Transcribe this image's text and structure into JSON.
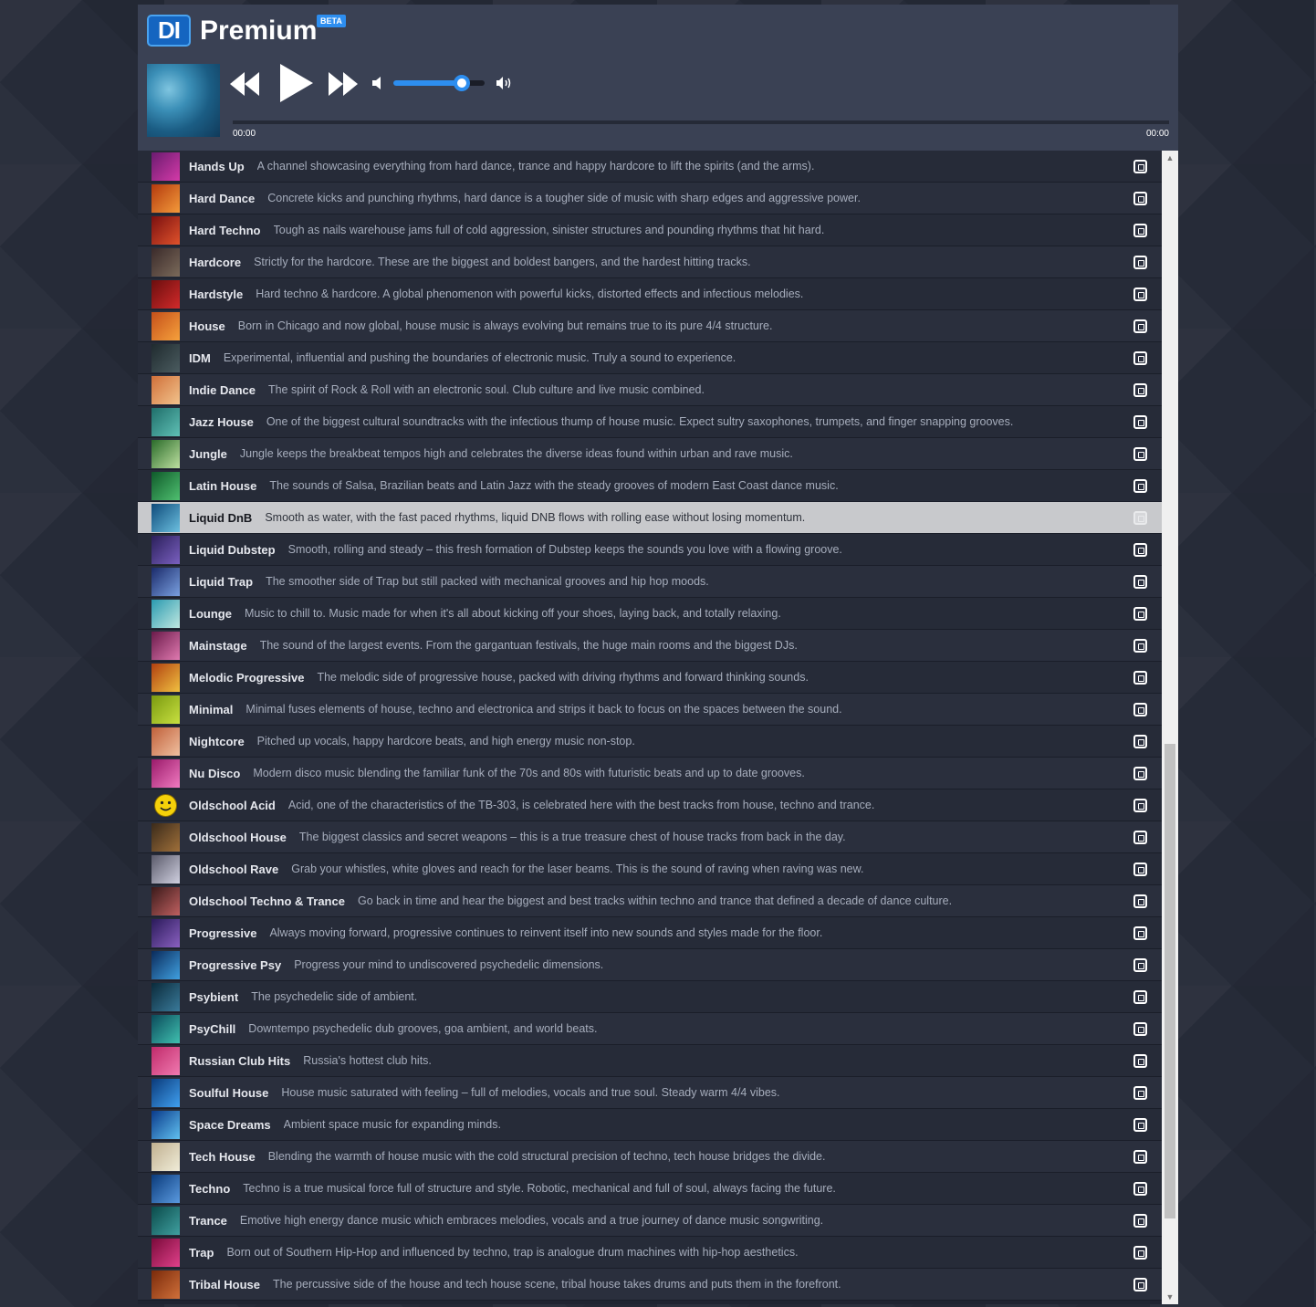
{
  "header": {
    "logo_text": "DI",
    "brand": "Premium",
    "beta": "BETA",
    "time_current": "00:00",
    "time_total": "00:00",
    "volume_percent": 75,
    "progress_percent": 0
  },
  "colors": {
    "accent": "#2d8ef0",
    "header_bg": "#3a4154",
    "list_bg": "#262b38",
    "selected_bg": "#c8c9cc"
  },
  "channels": [
    {
      "name": "Hands Up",
      "desc": "A channel showcasing everything from hard dance, trance and happy hardcore to lift the spirits (and the arms).",
      "thumb": [
        "#6a1b6f",
        "#d43aa8"
      ]
    },
    {
      "name": "Hard Dance",
      "desc": "Concrete kicks and punching rhythms, hard dance is a tougher side of music with sharp edges and aggressive power.",
      "thumb": [
        "#b33a0e",
        "#f39a3a"
      ]
    },
    {
      "name": "Hard Techno",
      "desc": "Tough as nails warehouse jams full of cold aggression, sinister structures and pounding rhythms that hit hard.",
      "thumb": [
        "#7a1010",
        "#e0522b"
      ]
    },
    {
      "name": "Hardcore",
      "desc": "Strictly for the hardcore. These are the biggest and boldest bangers, and the hardest hitting tracks.",
      "thumb": [
        "#3a2a2a",
        "#7b6a5a"
      ]
    },
    {
      "name": "Hardstyle",
      "desc": "Hard techno & hardcore. A global phenomenon with powerful kicks, distorted effects and infectious melodies.",
      "thumb": [
        "#6a0e0e",
        "#d22a2a"
      ]
    },
    {
      "name": "House",
      "desc": "Born in Chicago and now global, house music is always evolving but remains true to its pure 4/4 structure.",
      "thumb": [
        "#c4501a",
        "#f6a13c"
      ]
    },
    {
      "name": "IDM",
      "desc": "Experimental, influential and pushing the boundaries of electronic music. Truly a sound to experience.",
      "thumb": [
        "#1f2a2e",
        "#4b5c60"
      ]
    },
    {
      "name": "Indie Dance",
      "desc": "The spirit of Rock & Roll with an electronic soul. Club culture and live music combined.",
      "thumb": [
        "#d0703a",
        "#f2c38c"
      ]
    },
    {
      "name": "Jazz House",
      "desc": "One of the biggest cultural soundtracks with the infectious thump of house music. Expect sultry saxophones, trumpets, and finger snapping grooves.",
      "thumb": [
        "#1f6e6a",
        "#5fc0b5"
      ]
    },
    {
      "name": "Jungle",
      "desc": "Jungle keeps the breakbeat tempos high and celebrates the diverse ideas found within urban and rave music.",
      "thumb": [
        "#2a6b2a",
        "#bde0a0"
      ]
    },
    {
      "name": "Latin House",
      "desc": "The sounds of Salsa, Brazilian beats and Latin Jazz with the steady grooves of modern East Coast dance music.",
      "thumb": [
        "#0f5a2a",
        "#4fc070"
      ]
    },
    {
      "name": "Liquid DnB",
      "desc": "Smooth as water, with the fast paced rhythms, liquid DNB flows with rolling ease without losing momentum.",
      "thumb": [
        "#0e4a7a",
        "#6cc0e0"
      ],
      "selected": true
    },
    {
      "name": "Liquid Dubstep",
      "desc": "Smooth, rolling and steady – this fresh formation of Dubstep keeps the sounds you love with a flowing groove.",
      "thumb": [
        "#2a1f5a",
        "#7a60c0"
      ]
    },
    {
      "name": "Liquid Trap",
      "desc": "The smoother side of Trap but still packed with mechanical grooves and hip hop moods.",
      "thumb": [
        "#1a2a6a",
        "#7aa0e0"
      ]
    },
    {
      "name": "Lounge",
      "desc": "Music to chill to. Music made for when it's all about kicking off your shoes, laying back, and totally relaxing.",
      "thumb": [
        "#2a9ab0",
        "#c0e8e0"
      ]
    },
    {
      "name": "Mainstage",
      "desc": "The sound of the largest events. From the gargantuan festivals, the huge main rooms and the biggest DJs.",
      "thumb": [
        "#6a1a4a",
        "#e07ab0"
      ]
    },
    {
      "name": "Melodic Progressive",
      "desc": "The melodic side of progressive house, packed with driving rhythms and forward thinking sounds.",
      "thumb": [
        "#b04010",
        "#f0c040"
      ]
    },
    {
      "name": "Minimal",
      "desc": "Minimal fuses elements of house, techno and electronica and strips it back to focus on the spaces between the sound.",
      "thumb": [
        "#7a9a10",
        "#c8e040"
      ]
    },
    {
      "name": "Nightcore",
      "desc": "Pitched up vocals, happy hardcore beats, and high energy music non-stop.",
      "thumb": [
        "#c0603a",
        "#f0c0a0"
      ]
    },
    {
      "name": "Nu Disco",
      "desc": "Modern disco music blending the familiar funk of the 70s and 80s with futuristic beats and up to date grooves.",
      "thumb": [
        "#9a1a6a",
        "#f07ac0"
      ]
    },
    {
      "name": "Oldschool Acid",
      "desc": "Acid, one of the characteristics of the TB-303, is celebrated here with the best tracks from house, techno and trance.",
      "thumb": [
        "#262b38",
        "#262b38"
      ],
      "smiley": true
    },
    {
      "name": "Oldschool House",
      "desc": "The biggest classics and secret weapons – this is a true treasure chest of house tracks from back in the day.",
      "thumb": [
        "#3a2a1a",
        "#a0703a"
      ]
    },
    {
      "name": "Oldschool Rave",
      "desc": "Grab your whistles, white gloves and reach for the laser beams. This is the sound of raving when raving was new.",
      "thumb": [
        "#5a5a6a",
        "#d0d0e0"
      ]
    },
    {
      "name": "Oldschool Techno & Trance",
      "desc": "Go back in time and hear the biggest and best tracks within techno and trance that defined a decade of dance culture.",
      "thumb": [
        "#3a1a1a",
        "#c06060"
      ]
    },
    {
      "name": "Progressive",
      "desc": "Always moving forward, progressive continues to reinvent itself into new sounds and styles made for the floor.",
      "thumb": [
        "#2a1a5a",
        "#8a60c0"
      ]
    },
    {
      "name": "Progressive Psy",
      "desc": "Progress your mind to undiscovered psychedelic dimensions.",
      "thumb": [
        "#0a2a5a",
        "#40a0e0"
      ]
    },
    {
      "name": "Psybient",
      "desc": "The psychedelic side of ambient.",
      "thumb": [
        "#0a2a3a",
        "#3a7a9a"
      ]
    },
    {
      "name": "PsyChill",
      "desc": "Downtempo psychedelic dub grooves, goa ambient, and world beats.",
      "thumb": [
        "#0a4a5a",
        "#40c0b0"
      ]
    },
    {
      "name": "Russian Club Hits",
      "desc": "Russia's hottest club hits.",
      "thumb": [
        "#c02a6a",
        "#f07ab0"
      ]
    },
    {
      "name": "Soulful House",
      "desc": "House music saturated with feeling – full of melodies, vocals and true soul. Steady warm 4/4 vibes.",
      "thumb": [
        "#0a3a7a",
        "#40a0f0"
      ]
    },
    {
      "name": "Space Dreams",
      "desc": "Ambient space music for expanding minds.",
      "thumb": [
        "#0a3a8a",
        "#60c0f0"
      ]
    },
    {
      "name": "Tech House",
      "desc": "Blending the warmth of house music with the cold structural precision of techno, tech house bridges the divide.",
      "thumb": [
        "#c0b090",
        "#f0ecd8"
      ]
    },
    {
      "name": "Techno",
      "desc": "Techno is a true musical force full of structure and style. Robotic, mechanical and full of soul, always facing the future.",
      "thumb": [
        "#0a3a7a",
        "#5a9ae0"
      ]
    },
    {
      "name": "Trance",
      "desc": "Emotive high energy dance music which embraces melodies, vocals and a true journey of dance music songwriting.",
      "thumb": [
        "#0a4a4a",
        "#40a0a0"
      ]
    },
    {
      "name": "Trap",
      "desc": "Born out of Southern Hip-Hop and influenced by techno, trap is analogue drum machines with hip-hop aesthetics.",
      "thumb": [
        "#7a0a3a",
        "#e0408a"
      ]
    },
    {
      "name": "Tribal House",
      "desc": "The percussive side of the house and tech house scene, tribal house takes drums and puts them in the forefront.",
      "thumb": [
        "#7a2a0a",
        "#d0703a"
      ]
    }
  ]
}
